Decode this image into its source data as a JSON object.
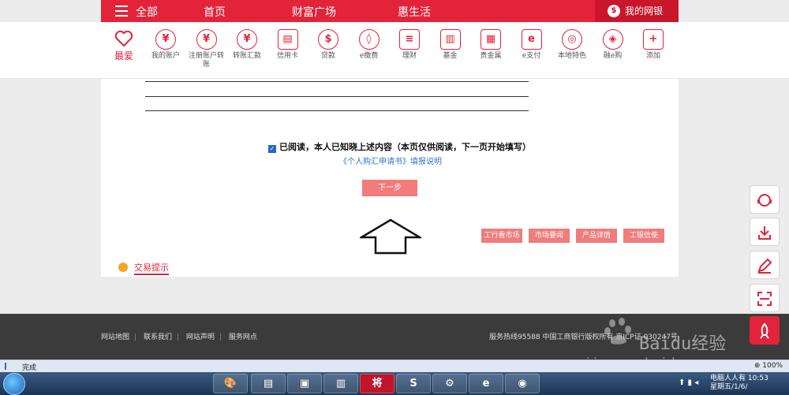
{
  "topnav": {
    "menu_label": "全部",
    "items": [
      "首页",
      "财富广场",
      "惠生活"
    ],
    "mybank_label": "我的网银"
  },
  "favorites_label": "最爱",
  "services": [
    {
      "label": "我的账户",
      "icon": "yen-circle-icon",
      "glyph": "¥"
    },
    {
      "label": "注册账户转账",
      "icon": "transfer-icon",
      "glyph": "¥"
    },
    {
      "label": "转账汇款",
      "icon": "remit-icon",
      "glyph": "¥"
    },
    {
      "label": "信用卡",
      "icon": "credit-card-icon",
      "glyph": "▤"
    },
    {
      "label": "贷款",
      "icon": "loan-bag-icon",
      "glyph": "$"
    },
    {
      "label": "e缴费",
      "icon": "water-drop-icon",
      "glyph": "◊"
    },
    {
      "label": "理财",
      "icon": "finance-icon",
      "glyph": "≡"
    },
    {
      "label": "基金",
      "icon": "fund-chart-icon",
      "glyph": "▥"
    },
    {
      "label": "贵金属",
      "icon": "gold-bar-icon",
      "glyph": "▦"
    },
    {
      "label": "e支付",
      "icon": "epay-icon",
      "glyph": "e"
    },
    {
      "label": "本地特色",
      "icon": "local-feature-icon",
      "glyph": "◎"
    },
    {
      "label": "融e购",
      "icon": "shopping-icon",
      "glyph": "◈"
    },
    {
      "label": "添加",
      "icon": "add-icon",
      "glyph": "+"
    }
  ],
  "form": {
    "agree_text": "已阅读，本人已知晓上述内容（本页仅供阅读，下一页开始填写）",
    "agree_checked": true,
    "guide_link": "《个人购汇申请书》填报说明",
    "next_button": "下一步"
  },
  "quick_links": [
    "工行看市场",
    "市场要闻",
    "产品详情",
    "工银信使"
  ],
  "tips_label": "交易提示",
  "footer": {
    "links": [
      "网站地图",
      "联系我们",
      "网站声明",
      "服务网点"
    ],
    "info": "服务热线95588    中国工商银行版权所有    京ICP证 030247号"
  },
  "side_buttons": [
    "customer-service-icon",
    "download-icon",
    "edit-icon",
    "scan-icon",
    "rocket-icon"
  ],
  "statusbar": {
    "status": "完成",
    "zoom": "100%"
  },
  "taskbar": {
    "app_icons": [
      "paint-icon",
      "folder-icon",
      "computer-icon",
      "files-icon",
      "chess-icon",
      "sogou-icon",
      "settings-icon",
      "ie-icon",
      "chrome-icon"
    ],
    "chess_glyph": "将",
    "tray_line1": "电脑人人有 10:53",
    "tray_line2": "星期五/1/6/"
  },
  "watermark": {
    "logo": "Baidu经验",
    "url": "jingyan.baidu.com"
  },
  "colors": {
    "brand_red": "#e2233a",
    "button_pink": "#f27b7b",
    "link_blue": "#2e78c9",
    "footer_bg": "#3b3b3b"
  }
}
